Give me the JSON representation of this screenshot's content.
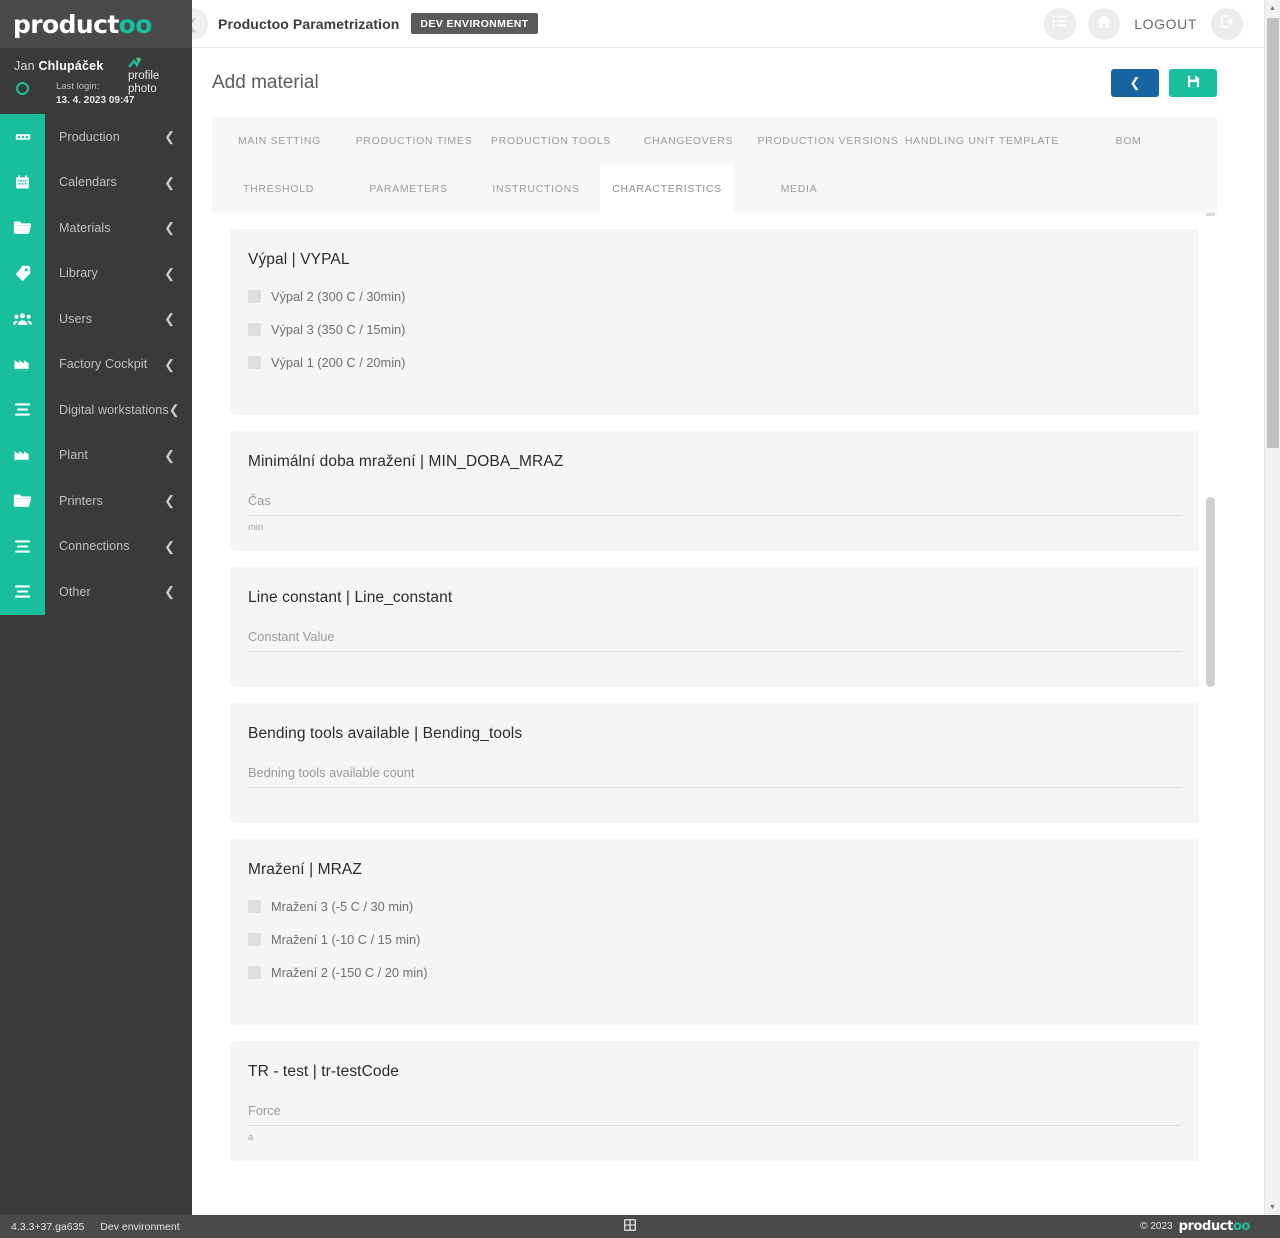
{
  "brand": {
    "logo_text": "product",
    "logo_suffix": "oo"
  },
  "user": {
    "first_name": "Jan",
    "last_name": "Chlupáček",
    "last_login_label": "Last login:",
    "last_login_value": "13. 4. 2023 09:47",
    "profile_photo_alt": "profile photo"
  },
  "sidebar": {
    "items": [
      {
        "label": "Production",
        "icon": "conveyor-icon"
      },
      {
        "label": "Calendars",
        "icon": "calendar-icon"
      },
      {
        "label": "Materials",
        "icon": "folder-icon"
      },
      {
        "label": "Library",
        "icon": "tags-icon"
      },
      {
        "label": "Users",
        "icon": "users-icon"
      },
      {
        "label": "Factory Cockpit",
        "icon": "factory-icon"
      },
      {
        "label": "Digital workstations",
        "icon": "list-icon"
      },
      {
        "label": "Plant",
        "icon": "factory-icon"
      },
      {
        "label": "Printers",
        "icon": "folder-icon"
      },
      {
        "label": "Connections",
        "icon": "list-icon"
      },
      {
        "label": "Other",
        "icon": "list-icon"
      }
    ]
  },
  "topbar": {
    "app_title": "Productoo Parametrization",
    "env_badge": "DEV ENVIRONMENT",
    "logout_label": "LOGOUT",
    "menu_icon": "list-menu-icon",
    "home_icon": "home-icon",
    "logout_icon": "logout-icon",
    "collapse_icon": "chevron-left-icon"
  },
  "page": {
    "title": "Add material",
    "back_button_icon": "chevron-left-icon",
    "save_button_icon": "save-disk-icon"
  },
  "tabs": {
    "row1": [
      "MAIN SETTING",
      "PRODUCTION TIMES",
      "PRODUCTION TOOLS",
      "CHANGEOVERS",
      "PRODUCTION VERSIONS",
      "HANDLING UNIT TEMPLATE",
      "BOM"
    ],
    "row2": [
      "THRESHOLD",
      "PARAMETERS",
      "INSTRUCTIONS",
      "CHARACTERISTICS",
      "MEDIA"
    ],
    "active": "CHARACTERISTICS"
  },
  "characteristics": [
    {
      "title": "Výpal | VYPAL",
      "type": "checkbox-group",
      "options": [
        "Výpal 2 (300 C / 30min)",
        "Výpal 3 (350 C / 15min)",
        "Výpal 1 (200 C / 20min)"
      ]
    },
    {
      "title": "Minimální doba mražení | MIN_DOBA_MRAZ",
      "type": "input",
      "field_label": "Čas",
      "field_value": "",
      "field_hint": "min"
    },
    {
      "title": "Line constant | Line_constant",
      "type": "input",
      "field_label": "Constant Value",
      "field_value": "",
      "field_hint": ""
    },
    {
      "title": "Bending tools available | Bending_tools",
      "type": "input",
      "field_label": "Bedning tools available count",
      "field_value": "",
      "field_hint": ""
    },
    {
      "title": "Mražení | MRAZ",
      "type": "checkbox-group",
      "options": [
        "Mražení 3 (-5 C / 30 min)",
        "Mražení 1 (-10 C / 15 min)",
        "Mražení 2 (-150 C / 20 min)"
      ]
    },
    {
      "title": "TR - test | tr-testCode",
      "type": "input",
      "field_label": "Force",
      "field_value": "",
      "field_hint": "a"
    }
  ],
  "footer": {
    "version": "4.3.3+37.ga635",
    "environment": "Dev environment",
    "grid_icon": "grid-icon",
    "copyright": "© 2023",
    "logo_text": "product",
    "logo_suffix": "oo"
  },
  "colors": {
    "accent_teal": "#19bf9c",
    "sidebar_dark": "#3a3a3a",
    "brand_bar": "#4a4a4a",
    "blue_button": "#1665a0",
    "card_bg": "#f5f5f5"
  }
}
